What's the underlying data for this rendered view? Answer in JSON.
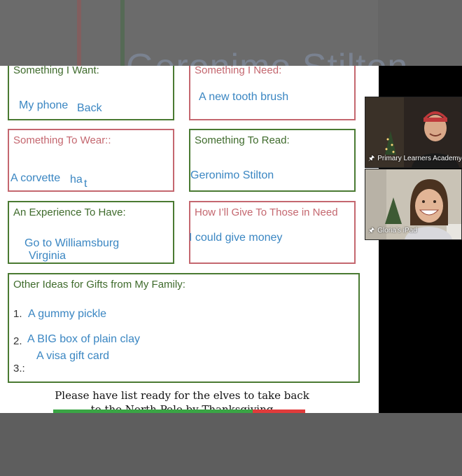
{
  "background": {
    "ghost_title": "Geronimo Stilton"
  },
  "slide": {
    "boxes": {
      "want": {
        "label": "Something I Want:",
        "answer_1": "My phone",
        "answer_2": "Back"
      },
      "need": {
        "label": "Something I Need:",
        "answer": "A new tooth brush"
      },
      "wear": {
        "label": "Something To Wear::",
        "answer_1": "A corvette",
        "answer_2": "ha",
        "answer_3": "t"
      },
      "read": {
        "label": "Something To Read:",
        "answer": "Geronimo Stilton"
      },
      "experience": {
        "label": "An Experience To Have:",
        "answer_1": "Go to Williamsburg",
        "answer_2": "Virginia"
      },
      "give": {
        "label": "How I’ll Give To Those in Need",
        "answer": "I could give money"
      }
    },
    "other_ideas": {
      "label": "Other Ideas for Gifts from My Family:",
      "numbers": [
        "1.",
        "2.",
        "3.:"
      ],
      "items": [
        "A gummy pickle",
        "A BIG box of plain clay",
        "A visa gift card"
      ]
    },
    "footer": {
      "line_1": "Please have list ready for the elves to take back",
      "line_2": "to the North Pole by Thanksgiving"
    }
  },
  "participants": [
    {
      "name": "Primary Learners Academy"
    },
    {
      "name": "Gloria’s iPad"
    }
  ],
  "colors": {
    "green": "#4a7a32",
    "rose": "#c4676f",
    "answer_blue": "#3a86c2",
    "progress_green": "#3aa545",
    "progress_red": "#e03b3b"
  }
}
